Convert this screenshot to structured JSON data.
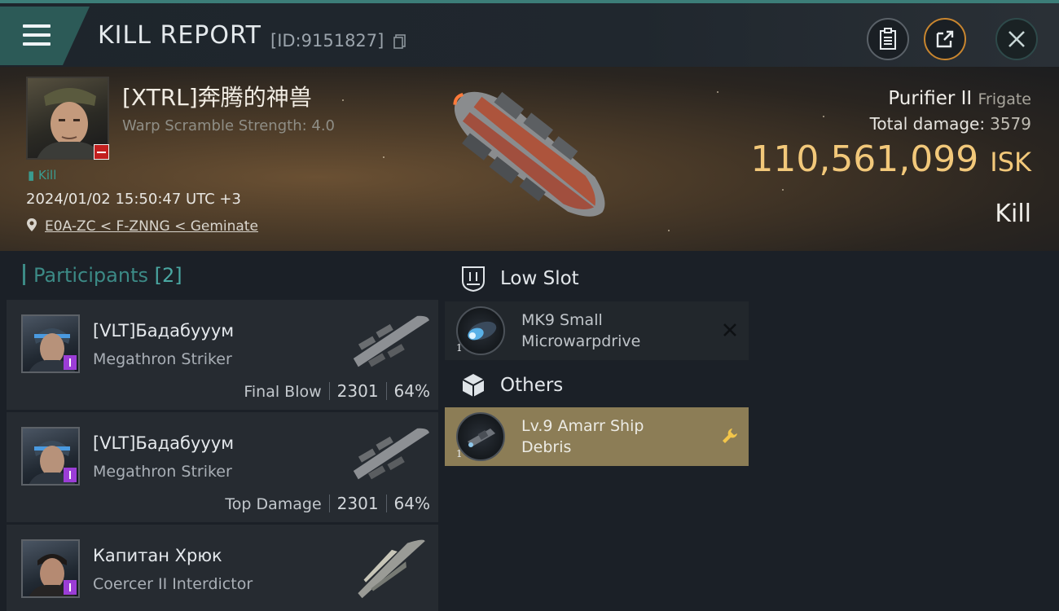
{
  "header": {
    "title": "KILL REPORT",
    "report_id": "[ID:9151827]",
    "buttons": [
      "clipboard-icon",
      "share-icon",
      "close-icon"
    ]
  },
  "victim": {
    "name": "[XTRL]奔腾的神兽",
    "warp_scramble": "Warp Scramble Strength: 4.0",
    "kill_tag": "Kill",
    "datetime": "2024/01/02 15:50:47 UTC +3",
    "location": "E0A-ZC < F-ZNNG < Geminate",
    "ship_name": "Purifier II",
    "ship_class": "Frigate",
    "total_damage_label": "Total damage:",
    "total_damage": "3579",
    "isk_value": "110,561,099",
    "isk_unit": "ISK",
    "outcome": "Kill"
  },
  "participants": {
    "label": "Participants",
    "count": "[2]",
    "rows": [
      {
        "name": "[VLT]Бадабууум",
        "ship": "Megathron Striker",
        "role": "Final Blow",
        "damage": "2301",
        "percent": "64%"
      },
      {
        "name": "[VLT]Бадабууум",
        "ship": "Megathron Striker",
        "role": "Top Damage",
        "damage": "2301",
        "percent": "64%"
      },
      {
        "name": "Капитан Хрюк",
        "ship": "Coercer II Interdictor",
        "role": "",
        "damage": "",
        "percent": ""
      }
    ]
  },
  "slots": {
    "low_slot_label": "Low Slot",
    "others_label": "Others",
    "low_items": [
      {
        "qty": "1",
        "line1": "MK9 Small",
        "line2": "Microwarpdrive",
        "status": "destroyed"
      }
    ],
    "other_items": [
      {
        "qty": "1",
        "line1": "Lv.9 Amarr Ship",
        "line2": "Debris",
        "status": "dropped"
      }
    ]
  },
  "colors": {
    "accent_teal": "#3c8a86",
    "isk_gold": "#f2c87a",
    "dropped_bg": "#8c7d56",
    "destroyed_bg": "#22272c",
    "participant_badge": "#9b3dd6",
    "victim_badge": "#c21f1f"
  }
}
